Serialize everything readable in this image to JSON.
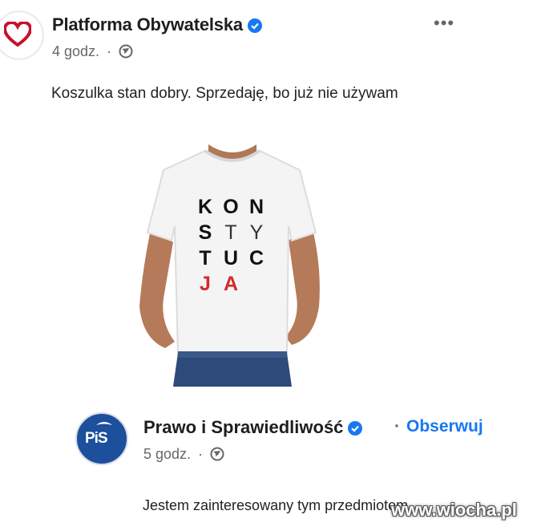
{
  "post": {
    "page_name": "Platforma Obywatelska",
    "time": "4 godz.",
    "meta_separator": "·",
    "text": "Koszulka stan dobry. Sprzedaję, bo już nie używam",
    "more": "•••",
    "avatar_icon": "heart-icon",
    "accent": "#c8102e"
  },
  "tshirt": {
    "rows": [
      {
        "l1": "K",
        "l2": "O",
        "l3": "N"
      },
      {
        "l1": "S",
        "l2": "T",
        "l3": "Y"
      },
      {
        "l1": "T",
        "l2": "U",
        "l3": "C"
      },
      {
        "l1": "J",
        "l2": "A",
        "l3": ""
      }
    ],
    "red": "#d42a2a"
  },
  "comment": {
    "page_name": "Prawo i Sprawiedliwość",
    "follow_separator": "·",
    "follow_label": "Obserwuj",
    "time": "5 godz.",
    "meta_separator": "·",
    "text": "Jestem zainteresowany tym przedmiotem",
    "avatar_text": "PiS",
    "brand": "#1c4f9c",
    "link": "#1877f2"
  },
  "watermark": "www.wiocha.pl"
}
